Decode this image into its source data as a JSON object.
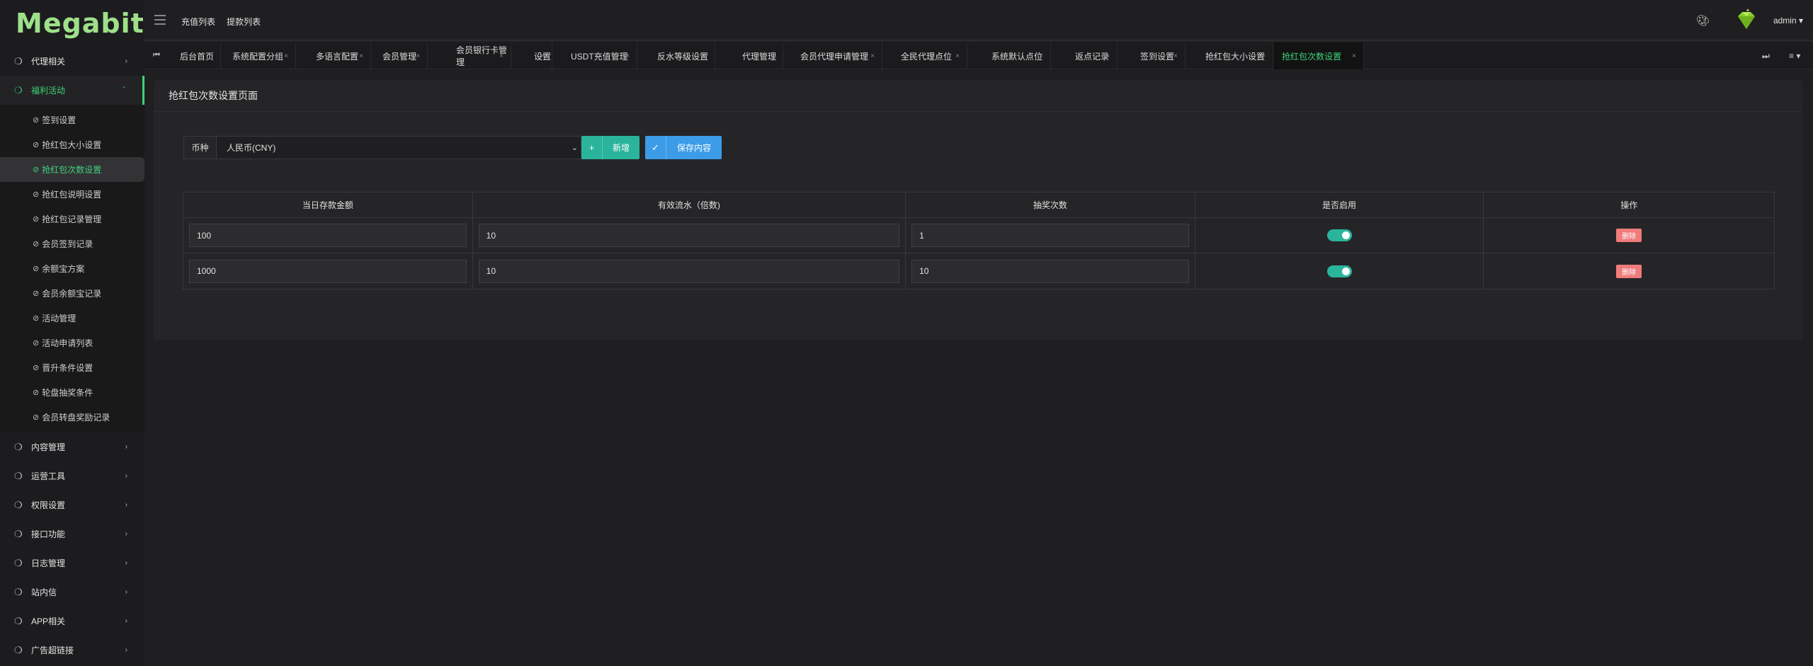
{
  "app": {
    "logo": "Megabit"
  },
  "sidebar": {
    "groups_top": [
      {
        "label": "代理相关",
        "icon": "leaf-icon"
      },
      {
        "label": "福利活动",
        "icon": "leaf-icon",
        "active": true
      }
    ],
    "submenu": [
      "签到设置",
      "抢红包大小设置",
      "抢红包次数设置",
      "抢红包说明设置",
      "抢红包记录管理",
      "会员签到记录",
      "余额宝方案",
      "会员余额宝记录",
      "活动管理",
      "活动申请列表",
      "晋升条件设置",
      "轮盘抽奖条件",
      "会员转盘奖励记录"
    ],
    "groups_bottom": [
      "内容管理",
      "运营工具",
      "权限设置",
      "接口功能",
      "日志管理",
      "站内信",
      "APP相关",
      "广告超链接"
    ]
  },
  "topbar": {
    "links": [
      "充值列表",
      "提款列表"
    ],
    "user": "admin",
    "icons": [
      "menu-icon",
      "palette-icon",
      "gem-avatar-icon"
    ]
  },
  "tabs": [
    "后台首页",
    "系统配置分组",
    "多语言配置",
    "会员管理",
    "会员银行卡管理",
    "设置",
    "USDT充值管理",
    "反水等级设置",
    "代理管理",
    "会员代理申请管理",
    "全民代理点位",
    "系统默认点位",
    "返点记录",
    "签到设置",
    "抢红包大小设置",
    "抢红包次数设置"
  ],
  "card": {
    "title": "抢红包次数设置页面",
    "currency_label": "币种",
    "currency_value": "人民币(CNY)",
    "add_button": "新增",
    "save_button": "保存内容"
  },
  "table": {
    "headers": [
      "当日存款金额",
      "有效流水（倍数)",
      "抽奖次数",
      "是否启用",
      "操作"
    ],
    "rows": [
      {
        "deposit": "100",
        "multiplier": "10",
        "draws": "1",
        "enabled": true,
        "action": "删除"
      },
      {
        "deposit": "1000",
        "multiplier": "10",
        "draws": "10",
        "enabled": true,
        "action": "删除"
      }
    ]
  },
  "colors": {
    "accent": "#3fd27a",
    "teal": "#2ab49c",
    "blue": "#3c9ce8",
    "danger": "#f07b7b",
    "logo": "#9ee08a"
  }
}
